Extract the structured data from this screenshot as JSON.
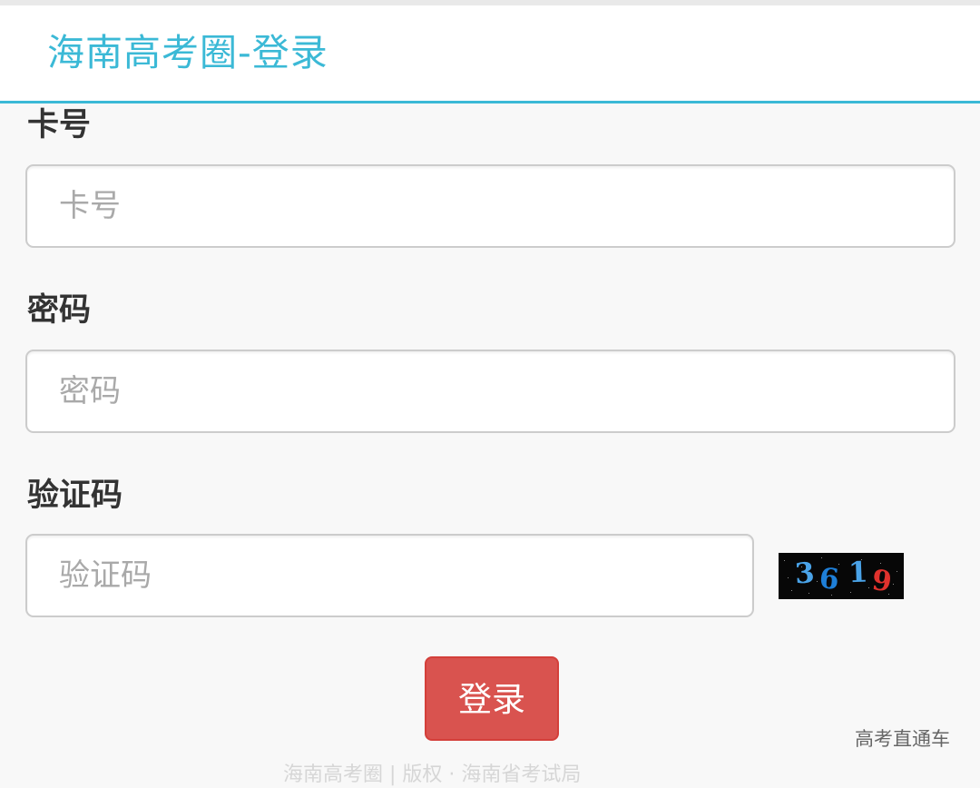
{
  "header": {
    "title": "海南高考圈-登录"
  },
  "form": {
    "card": {
      "label": "卡号",
      "placeholder": "卡号"
    },
    "password": {
      "label": "密码",
      "placeholder": "密码"
    },
    "captcha": {
      "label": "验证码",
      "placeholder": "验证码",
      "image_text": "3619"
    },
    "submit_label": "登录"
  },
  "footer": {
    "link_label": "高考直通车",
    "faded_text": "海南高考圈 | 版权 · 海南省考试局"
  },
  "colors": {
    "accent": "#3bb9d6",
    "button": "#d9534f",
    "captcha_digit_1": "#4aa3e8",
    "captcha_digit_2": "#1e7fd8",
    "captcha_digit_3": "#4aa3e8",
    "captcha_digit_4": "#e0322d"
  }
}
